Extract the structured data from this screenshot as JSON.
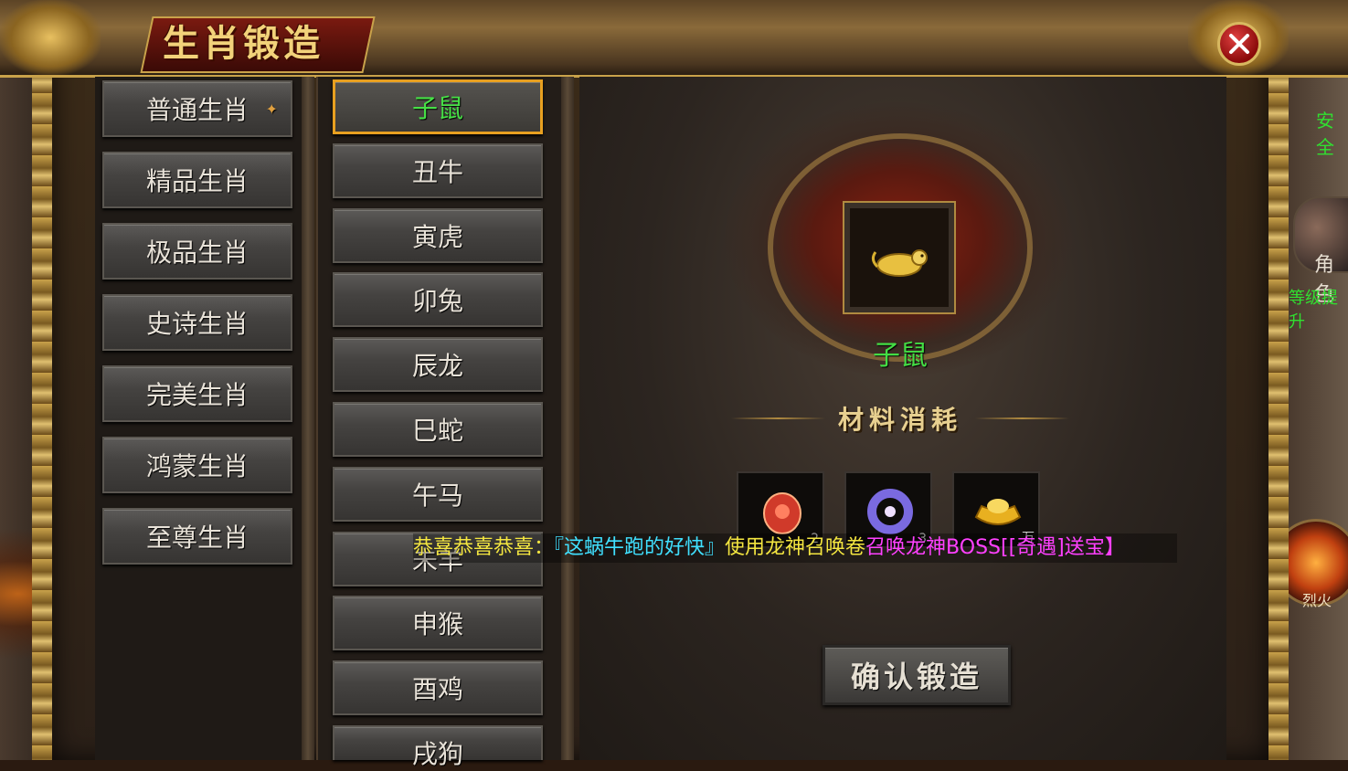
{
  "window": {
    "title": "生肖锻造"
  },
  "categories": [
    {
      "label": "普通生肖",
      "selected": true
    },
    {
      "label": "精品生肖"
    },
    {
      "label": "极品生肖"
    },
    {
      "label": "史诗生肖"
    },
    {
      "label": "完美生肖"
    },
    {
      "label": "鸿蒙生肖"
    },
    {
      "label": "至尊生肖"
    }
  ],
  "zodiacs": [
    {
      "label": "子鼠",
      "selected": true
    },
    {
      "label": "丑牛"
    },
    {
      "label": "寅虎"
    },
    {
      "label": "卯兔"
    },
    {
      "label": "辰龙"
    },
    {
      "label": "巳蛇"
    },
    {
      "label": "午马"
    },
    {
      "label": "未羊"
    },
    {
      "label": "申猴"
    },
    {
      "label": "酉鸡"
    },
    {
      "label": "戌狗"
    }
  ],
  "forge": {
    "selected_item_name": "子鼠",
    "materials_title": "材料消耗",
    "materials": [
      {
        "icon": "red-gem-icon",
        "quantity": "2"
      },
      {
        "icon": "purple-ring-icon",
        "quantity": "3"
      },
      {
        "icon": "gold-ingot-icon",
        "quantity": "万"
      }
    ],
    "confirm_label": "确认锻造"
  },
  "broadcast": {
    "prefix": "恭喜恭喜恭喜：",
    "player": "『这蜗牛跑的好快』",
    "action": "使用龙神召唤卷",
    "message": "召唤龙神BOSS[[奇遇]送宝】"
  },
  "hud": {
    "safe_zone": "安全",
    "role": "角色",
    "upgrade": "等级提升",
    "skill": "烈火"
  },
  "colors": {
    "selected_text": "#44dd44",
    "selected_border": "#e8a020",
    "broadcast_congrats": "#f4e640",
    "broadcast_player": "#40e0ff",
    "broadcast_boss": "#ff40ff"
  }
}
